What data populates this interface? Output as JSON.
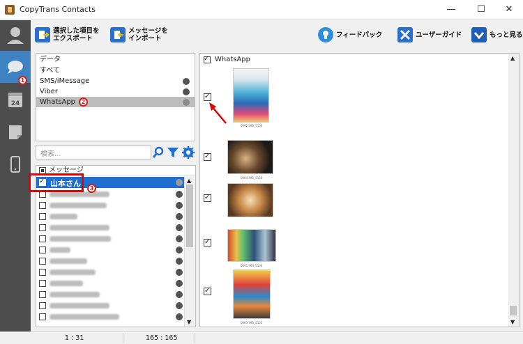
{
  "window": {
    "title": "CopyTrans Contacts",
    "minimize": "—",
    "maximize": "☐",
    "close": "✕"
  },
  "sidebar": {
    "items": [
      {
        "name": "contacts",
        "icon": "person-icon"
      },
      {
        "name": "messages",
        "icon": "speech-bubble-icon",
        "active": true,
        "badge": "1"
      },
      {
        "name": "calendar",
        "icon": "calendar-icon",
        "label": "24"
      },
      {
        "name": "notes",
        "icon": "note-icon"
      },
      {
        "name": "device",
        "icon": "phone-icon"
      }
    ]
  },
  "toolbar": {
    "export_label": "選択した項目を\nエクスポート",
    "import_label": "メッセージを\nインポート",
    "feedback_label": "フィードバック",
    "guide_label": "ユーザーガイド",
    "more_label": "もっと見る"
  },
  "categories": {
    "items": [
      "データ",
      "すべて",
      "SMS/iMessage",
      "Viber",
      "WhatsApp"
    ],
    "selected": "WhatsApp",
    "badge": "2"
  },
  "search": {
    "placeholder": "検索..."
  },
  "contacts": {
    "header": "メッセージ",
    "selected_name": "山本さん",
    "badge": "3"
  },
  "photos": {
    "header": "WhatsApp",
    "items": [
      {
        "caption": "0002 IMG_5153"
      },
      {
        "caption": "0004 IMG_5150"
      },
      {
        "caption": ""
      },
      {
        "caption": "0001 IMG_5134"
      },
      {
        "caption": "0003 IMG_5152"
      }
    ]
  },
  "status": {
    "left": "1 : 31",
    "middle": "165 : 165"
  },
  "colors": {
    "accent": "#1f6fd1",
    "sidebar": "#4d4d4d",
    "sidebar_active": "#3e82c4",
    "annotation": "#e00000"
  }
}
